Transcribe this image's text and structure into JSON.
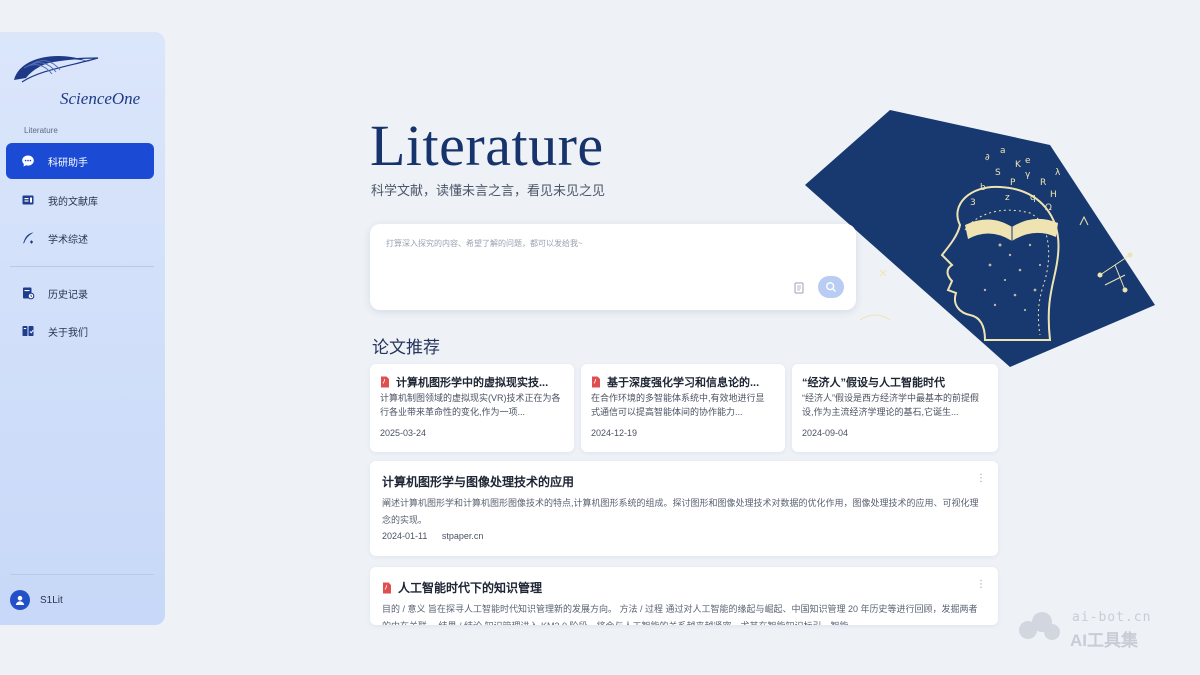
{
  "brand": {
    "name": "ScienceOne"
  },
  "sidebar": {
    "section_label": "Literature",
    "items": [
      {
        "label": "科研助手",
        "icon": "chat-icon",
        "active": true
      },
      {
        "label": "我的文献库",
        "icon": "library-icon",
        "active": false
      },
      {
        "label": "学术综述",
        "icon": "quill-icon",
        "active": false
      },
      {
        "label": "历史记录",
        "icon": "history-icon",
        "active": false
      },
      {
        "label": "关于我们",
        "icon": "about-icon",
        "active": false
      }
    ],
    "user": {
      "name": "S1Lit"
    }
  },
  "hero": {
    "title": "Literature",
    "subtitle": "科学文献，读懂未言之言，看见未见之见"
  },
  "search": {
    "placeholder": "打算深入探究的内容、希望了解的问题，都可以发给我~"
  },
  "recommend": {
    "title": "论文推荐",
    "cards": [
      {
        "title": "计算机图形学中的虚拟现实技...",
        "desc": "计算机制图领域的虚拟现实(VR)技术正在为各行各业带来革命性的变化,作为一项...",
        "date": "2025-03-24",
        "pdf": true
      },
      {
        "title": "基于深度强化学习和信息论的...",
        "desc": "在合作环境的多智能体系统中,有效地进行显式通信可以提高智能体间的协作能力...",
        "date": "2024-12-19",
        "pdf": true
      },
      {
        "title": "“经济人”假设与人工智能时代",
        "desc": "“经济人”假设是西方经济学中最基本的前提假设,作为主流经济学理论的基石,它诞生...",
        "date": "2024-09-04",
        "pdf": false
      }
    ],
    "list": [
      {
        "title": "计算机图形学与图像处理技术的应用",
        "desc": "阐述计算机图形学和计算机图形图像技术的特点,计算机图形系统的组成。探讨图形和图像处理技术对数据的优化作用，图像处理技术的应用、可视化理念的实现。",
        "date": "2024-01-11",
        "source": "stpaper.cn",
        "pdf": false
      },
      {
        "title": "人工智能时代下的知识管理",
        "desc": "目的 / 意义 旨在探寻人工智能时代知识管理新的发展方向。 方法 / 过程 通过对人工智能的缘起与崛起、中国知识管理 20 年历史等进行回顾，发掘两者的内在关联。 结果 / 结论 知识管理进入 KM3.0 阶段，将会与人工智能的关系越来越紧密，尤其在智能知识标引、智能",
        "date": "",
        "source": "",
        "pdf": true
      }
    ],
    "more_glyph": "⋮"
  },
  "watermark": {
    "line1": "ai-bot.cn",
    "line2": "AI工具集"
  },
  "colors": {
    "accent": "#1b4bd4",
    "hero_title": "#16336b",
    "art_bg": "#17396f",
    "art_chalk": "#efe3b2"
  }
}
